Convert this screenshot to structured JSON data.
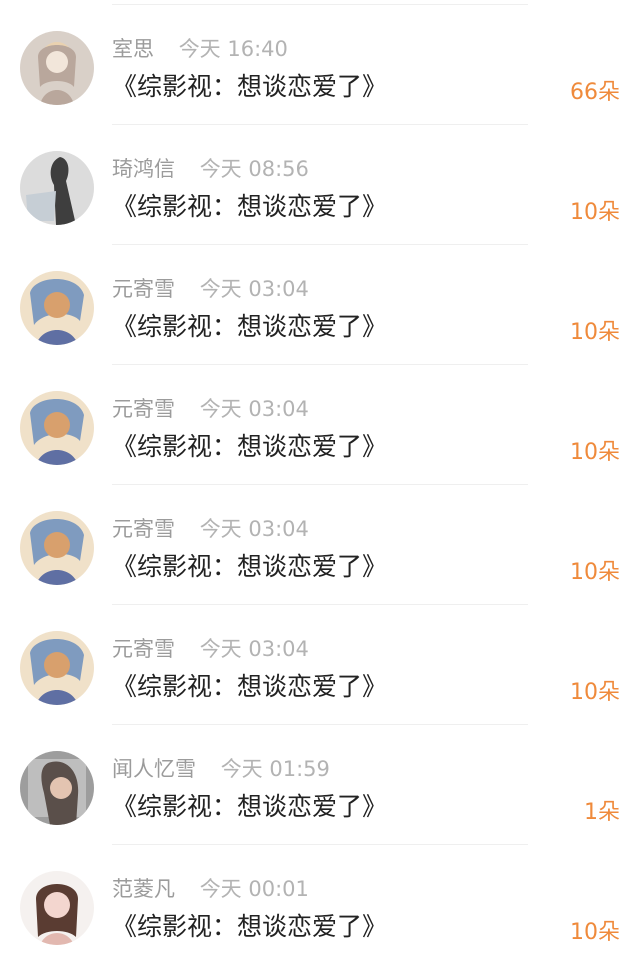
{
  "messages": [
    {
      "name": "室思",
      "time": "今天 16:40",
      "title": "《综影视：想谈恋爱了》",
      "count": "66朵",
      "avatar_icon": "avatar-anime-girl-blonde",
      "avatar_colors": [
        "#d9d0c8",
        "#ead2b0",
        "#b9a79c",
        "#f2e6da"
      ]
    },
    {
      "name": "琦鸿信",
      "time": "今天 08:56",
      "title": "《综影视：想谈恋爱了》",
      "count": "10朵",
      "avatar_icon": "avatar-silhouette-monochrome",
      "avatar_colors": [
        "#d9d9d9",
        "#1f1f1f",
        "#bfc8d1",
        "#f1f1f1"
      ]
    },
    {
      "name": "元寄雪",
      "time": "今天 03:04",
      "title": "《综影视：想谈恋爱了》",
      "count": "10朵",
      "avatar_icon": "avatar-anime-blue-hair",
      "avatar_colors": [
        "#7f9bbf",
        "#d8a06d",
        "#f0e1c9",
        "#5f6fa3"
      ]
    },
    {
      "name": "元寄雪",
      "time": "今天 03:04",
      "title": "《综影视：想谈恋爱了》",
      "count": "10朵",
      "avatar_icon": "avatar-anime-blue-hair",
      "avatar_colors": [
        "#7f9bbf",
        "#d8a06d",
        "#f0e1c9",
        "#5f6fa3"
      ]
    },
    {
      "name": "元寄雪",
      "time": "今天 03:04",
      "title": "《综影视：想谈恋爱了》",
      "count": "10朵",
      "avatar_icon": "avatar-anime-blue-hair",
      "avatar_colors": [
        "#7f9bbf",
        "#d8a06d",
        "#f0e1c9",
        "#5f6fa3"
      ]
    },
    {
      "name": "元寄雪",
      "time": "今天 03:04",
      "title": "《综影视：想谈恋爱了》",
      "count": "10朵",
      "avatar_icon": "avatar-anime-blue-hair",
      "avatar_colors": [
        "#7f9bbf",
        "#d8a06d",
        "#f0e1c9",
        "#5f6fa3"
      ]
    },
    {
      "name": "闻人忆雪",
      "time": "今天 01:59",
      "title": "《综影视：想谈恋爱了》",
      "count": "1朵",
      "avatar_icon": "avatar-photo-girl-dark-hair",
      "avatar_colors": [
        "#9d9d9d",
        "#5a4f4a",
        "#e3c4b1",
        "#d9d9d9"
      ]
    },
    {
      "name": "范菱凡",
      "time": "今天 00:01",
      "title": "《综影视：想谈恋爱了》",
      "count": "10朵",
      "avatar_icon": "avatar-illustrated-girl-brown-hair",
      "avatar_colors": [
        "#f5f1ef",
        "#5a3c32",
        "#f3d6cf",
        "#e2b8b0"
      ]
    }
  ]
}
